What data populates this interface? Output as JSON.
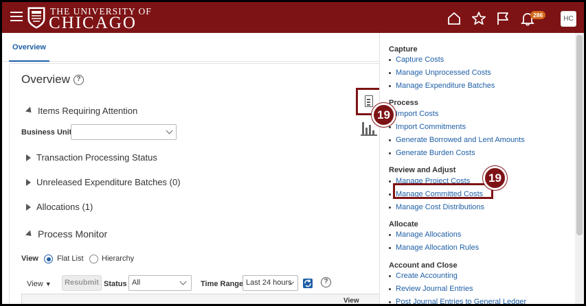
{
  "header": {
    "university_top": "THE UNIVERSITY OF",
    "university_bottom": "CHICAGO",
    "notification_count": "286",
    "user_initials": "HC"
  },
  "tabs": [
    {
      "label": "Overview"
    }
  ],
  "overview": {
    "title": "Overview",
    "help": "?",
    "items_requiring_attention": "Items Requiring Attention",
    "business_unit_label": "Business Unit",
    "business_unit_value": "",
    "transaction_processing_status": "Transaction Processing Status",
    "unreleased_batches": "Unreleased Expenditure Batches (0)",
    "allocations": "Allocations (1)",
    "process_monitor": "Process Monitor",
    "view_label": "View",
    "radio_flat_list": "Flat List",
    "radio_hierarchy": "Hierarchy",
    "view_menu": "View",
    "resubmit": "Resubmit",
    "status_label": "Status",
    "status_value": "All",
    "time_range_label": "Time Range",
    "time_range_value": "Last 24 hours",
    "table_col_view": "View"
  },
  "callouts": {
    "step_number": "19"
  },
  "tasks": {
    "groups": [
      {
        "title": "Capture",
        "links": [
          "Capture Costs",
          "Manage Unprocessed Costs",
          "Manage Expenditure Batches"
        ]
      },
      {
        "title": "Process",
        "links": [
          "Import Costs",
          "Import Commitments",
          "Generate Borrowed and Lent Amounts",
          "Generate Burden Costs"
        ]
      },
      {
        "title": "Review and Adjust",
        "links": [
          "Manage Project Costs",
          "Manage Committed Costs",
          "Manage Cost Distributions"
        ]
      },
      {
        "title": "Allocate",
        "links": [
          "Manage Allocations",
          "Manage Allocation Rules"
        ]
      },
      {
        "title": "Account and Close",
        "links": [
          "Create Accounting",
          "Review Journal Entries",
          "Post Journal Entries to General Ledger"
        ]
      }
    ]
  },
  "colors": {
    "brand": "#7d1315",
    "link": "#1f5fa6",
    "badge": "#d4671a"
  }
}
